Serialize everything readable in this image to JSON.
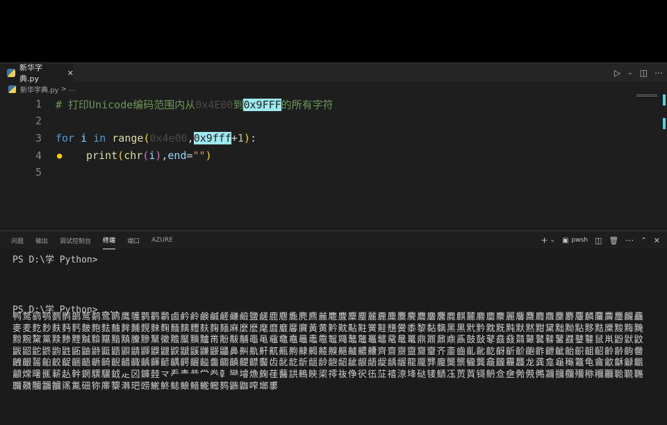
{
  "tab": {
    "label": "新华字典.py",
    "close": "✕"
  },
  "breadcrumb": {
    "file": "新华字典.py",
    "sep": ">",
    "more": "..."
  },
  "editor": {
    "line_numbers": [
      "1",
      "2",
      "3",
      "4",
      "5"
    ],
    "line1": {
      "comment_pre": "# 打印Unicode编码范围内从",
      "dim": "0x4E00",
      "to": "到",
      "hl": "0x9FFF",
      "post": "的所有字符"
    },
    "line3": {
      "for": "for",
      "i": " i ",
      "in": "in",
      "range": " range",
      "open": "(",
      "dim": "0x4e00",
      "comma": ",",
      "hl": "0x9fff",
      "plus": "+",
      "one": "1",
      "close": ")",
      "colon": ":"
    },
    "line4": {
      "print": "print",
      "open": "(",
      "chr": "chr",
      "open2": "(",
      "i": "i",
      "close2": ")",
      "comma": ",",
      "end": "end",
      "eq": "=",
      "str": "\"\"",
      "close": ")"
    }
  },
  "panel": {
    "tabs": [
      "问题",
      "输出",
      "调试控制台",
      "终端",
      "端口",
      "AZURE"
    ],
    "active_tab": "终端",
    "shell": "pwsh",
    "icons": [
      "plus-icon",
      "chevron-down-icon",
      "terminal-icon",
      "split-icon",
      "trash-icon",
      "more-icon",
      "maximize-icon",
      "close-icon"
    ]
  },
  "terminal": {
    "prompt1": "PS D:\\学 Python>",
    "prompt2": "PS D:\\学 Python> ...",
    "chars": "鸭鹜鹞鹗鹦鹘鹚鹫鹬鹭鹮鹰鹱鹲鹳鹴鹵鹶鹷鹸鹹鹺鹻鹼鹽鹾鹿麀麁麂麃麄麅麆麇麈麉麊麋麌麍麎麏麐麑麒麓麔麕麖麗麘麙麚麛麜麝麞麟麠麡麢麣麤麥麦麧麨麩麪麫麬麭麮麯麰麱麲麳麴麵麶麷麸麹麺麻麼麽麾麿黀黁黂黃黄黅黆黇黈黉黊黋黌黍黎黏黐黑黒黓黔黕黖黗默黙黚黛黜黝點黟黠黡黢黣黤黥黦黧黨黩黪黫黬黭黮黯黰黱黲黳黴黵黶黷黸黹黺黻黼黽黾黿鼀鼁鼂鼃鼄鼅鼆鼇鼈鼉鼊鼋鼌鼍鼎鼏鼐鼑鼒鼓鼔鼕鼖鼗鼘鼙鼚鼛鼜鼝鼞鼟鼠鼡鼢鼣鼤鼥鼦鼧鼨鼩鼪鼫鼬鼭鼮鼯鼰鼱鼲鼳鼴鼵鼶鼷鼸鼹鼺鼻鼼鼽鼾鼿齀齁齂齃齄齅齆齇齈齉齊齋齌齍齎齏齐齑齒齓齔齕齖齗齘齙齚齛齜齝齞齟齠齡齢齣齤齥齦齧齨齩齪齫齬齭齮齯齰齱齲齳齴齵齶齷齸齹齺齻齼齽齾齿龀龁龂龃龄龅龆龇龈龉龊龋龌龍龎龏龐龑龒龓龔龕龖龗龘龙龚龛龜龝龞龟龠龡龢龣龤龥龦龧龨龩龪龫龬龭龮龯龰龱龲龳龴龵龶龷龸龹龺龻龼龽龾龿鿀鿁鿂鿃鿄鿅鿆鿇鿈鿉鿊鿋鿌鿍鿎鿏鿐鿑鿒鿓鿔鿕鿖鿗鿘鿙鿚鿛鿜鿝鿞鿟鿠鿡鿢鿣鿤鿥鿦鿧鿨鿩鿪鿫鿬鿭鿮鿯鿰鿱鿲鿳鿴鿵鿶鿷鿸鿹鿺鿻鿼鿽鿾鿿"
  }
}
